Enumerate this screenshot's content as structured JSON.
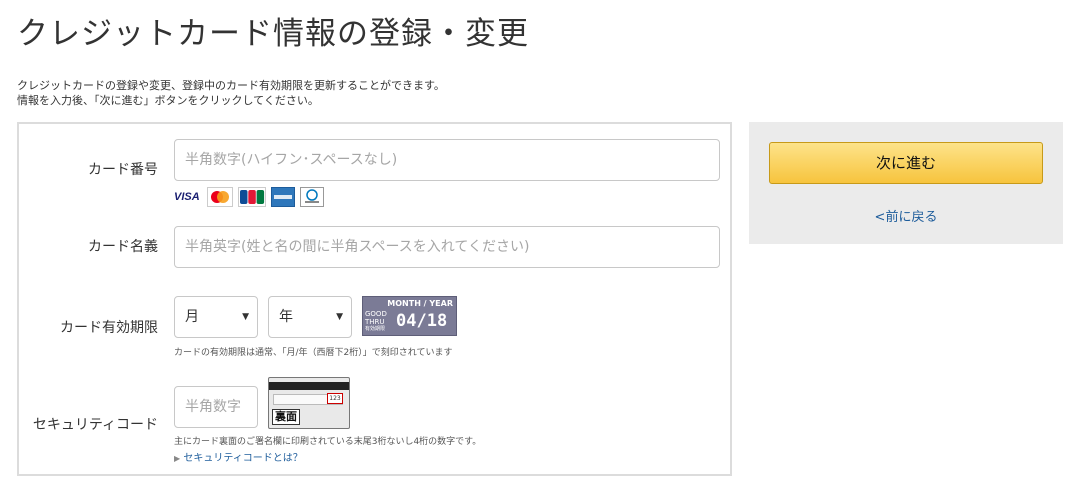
{
  "page": {
    "title": "クレジットカード情報の登録・変更",
    "intro_line1": "クレジットカードの登録や変更、登録中のカード有効期限を更新することができます。",
    "intro_line2": "情報を入力後、「次に進む」ボタンをクリックしてください。"
  },
  "form": {
    "card_number": {
      "label": "カード番号",
      "placeholder": "半角数字(ハイフン･スペースなし)",
      "value": ""
    },
    "card_brands": {
      "visa": "VISA",
      "mastercard_icon": "mastercard-logo-icon",
      "jcb": "JCB",
      "amex_icon": "amex-logo-icon",
      "diners_icon": "diners-club-logo-icon"
    },
    "card_name": {
      "label": "カード名義",
      "placeholder": "半角英字(姓と名の間に半角スペースを入れてください)",
      "value": ""
    },
    "expiry": {
      "label": "カード有効期限",
      "month_selected": "月",
      "year_selected": "年",
      "sample_header": "MONTH / YEAR",
      "sample_good": "GOOD",
      "sample_thru": "THRU",
      "sample_jp": "有効期限",
      "sample_value": "04/18",
      "hint": "カードの有効期限は通常、「月/年（西暦下2桁）」で刻印されています"
    },
    "security_code": {
      "label": "セキュリティコード",
      "placeholder": "半角数字",
      "value": "",
      "sample_back_label": "裏面",
      "sample_code": "123",
      "hint": "主にカード裏面のご署名欄に印刷されている末尾3桁ないし4桁の数字です。",
      "help_link": "セキュリティコードとは？"
    }
  },
  "actions": {
    "next_label": "次に進む",
    "back_label": "<前に戻る"
  },
  "colors": {
    "accent_button": "#f7c43d",
    "link": "#1d5c9b",
    "panel_bg": "#ebebeb",
    "border": "#dcdcdc"
  }
}
